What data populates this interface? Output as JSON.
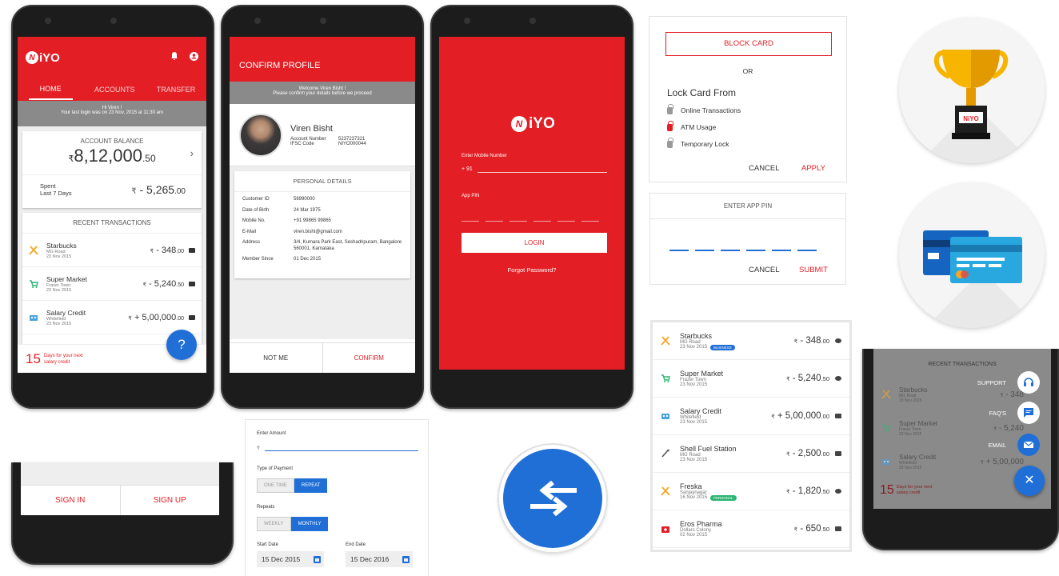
{
  "brand": {
    "logo_text": "NiYO",
    "accent": "#e31e24",
    "blue": "#1f6fd6"
  },
  "home": {
    "tabs": [
      "HOME",
      "ACCOUNTS",
      "TRANSFER"
    ],
    "greeting": "Hi Viren !",
    "last_login": "Your last login was on 23 Nov, 2015 at 11:30 am",
    "balance_label": "ACCOUNT BALANCE",
    "balance_main": "8,12,000",
    "balance_dec": ".50",
    "spent_label": "Spent",
    "spent_period": "Last 7 Days",
    "spent_main": "- 5,265",
    "spent_dec": ".00",
    "recent_title": "RECENT TRANSACTIONS",
    "transactions": [
      {
        "name": "Starbucks",
        "place": "MG Road",
        "date": "23 Nov 2015",
        "amount": "- 348",
        "dec": ".00",
        "icon": "fork-knife-icon"
      },
      {
        "name": "Super Market",
        "place": "Frazer Town",
        "date": "23 Nov 2015",
        "amount": "- 5,240",
        "dec": ".50",
        "icon": "cart-icon"
      },
      {
        "name": "Salary Credit",
        "place": "Whitefield",
        "date": "23 Nov 2015",
        "amount": "+ 5,00,000",
        "dec": ".00",
        "icon": "building-icon"
      }
    ],
    "days_num": "15",
    "days_text1": "Days for your next",
    "days_text2": "salary credit",
    "help": "?"
  },
  "confirm": {
    "title": "CONFIRM PROFILE",
    "welcome": "Welcome Viren Bisht !",
    "instruction": "Please confirm your details before we proceed",
    "name": "Viren Bisht",
    "acct_label": "Account Number",
    "acct_value": "5237237321",
    "ifsc_label": "IFSC Code",
    "ifsc_value": "NIYO000044",
    "section": "PERSONAL DETAILS",
    "details": [
      {
        "label": "Customer ID",
        "value": "56990000"
      },
      {
        "label": "Date of Birth",
        "value": "24 Mar 1975"
      },
      {
        "label": "Mobile No.",
        "value": "+91 99865 99865"
      },
      {
        "label": "E-Mail",
        "value": "viren.bisht@gmail.com"
      },
      {
        "label": "Address",
        "value": "3/4, Kumara Park East, Seshadripuram, Bangalore 560001, Karnataka"
      },
      {
        "label": "Member Since",
        "value": "01 Dec 2015"
      }
    ],
    "not_me": "NOT ME",
    "confirm_btn": "CONFIRM"
  },
  "login": {
    "mobile_label": "Enter Mobile Number",
    "prefix": "+ 91",
    "pin_label": "App PIN",
    "login_btn": "LOGIN",
    "forgot": "Forgot Password?"
  },
  "block": {
    "block_btn": "BLOCK CARD",
    "or": "OR",
    "lock_title": "Lock Card From",
    "options": [
      "Online Transactions",
      "ATM Usage",
      "Temporary Lock"
    ],
    "cancel": "CANCEL",
    "apply": "APPLY"
  },
  "pin": {
    "title": "ENTER APP PIN",
    "cancel": "CANCEL",
    "submit": "SUBMIT"
  },
  "signin": {
    "sign_in": "SIGN IN",
    "sign_up": "SIGN UP"
  },
  "payment": {
    "amount_label": "Enter Amount",
    "rupee": "₹",
    "type_label": "Type of Payment",
    "type_opts": [
      "ONE TIME",
      "REPEAT"
    ],
    "repeats_label": "Repeats",
    "repeat_opts": [
      "WEEKLY",
      "MONTHLY"
    ],
    "start_label": "Start Date",
    "start_value": "15 Dec 2015",
    "end_label": "End Date",
    "end_value": "15 Dec 2016"
  },
  "txlist": [
    {
      "name": "Starbucks",
      "place": "MG Road",
      "date": "23 Nov 2015",
      "tag": "BUSINESS",
      "amount": "- 348",
      "dec": ".00",
      "icon": "fork-knife-icon"
    },
    {
      "name": "Super Market",
      "place": "Frazer Town",
      "date": "23 Nov 2015",
      "tag": "",
      "amount": "- 5,240",
      "dec": ".50",
      "icon": "cart-icon"
    },
    {
      "name": "Salary Credit",
      "place": "Whitefield",
      "date": "23 Nov 2015",
      "tag": "",
      "amount": "+ 5,00,000",
      "dec": ".00",
      "icon": "building-icon"
    },
    {
      "name": "Shell Fuel Station",
      "place": "MG Road",
      "date": "23 Nov 2015",
      "tag": "",
      "amount": "- 2,500",
      "dec": ".00",
      "icon": "fuel-icon"
    },
    {
      "name": "Freska",
      "place": "Sanjaynagar",
      "date": "16 Nov 2015",
      "tag": "PERSONAL",
      "amount": "- 1,820",
      "dec": ".50",
      "icon": "fork-knife-icon"
    },
    {
      "name": "Eros Pharma",
      "place": "Dollars Colony",
      "date": "02 Nov 2015",
      "tag": "",
      "amount": "- 650",
      "dec": ".50",
      "icon": "pharmacy-icon"
    }
  ],
  "fab_menu": {
    "recent_title": "RECENT TRANSACTIONS",
    "items": [
      "SUPPORT",
      "FAQ'S",
      "EMAIL"
    ],
    "bg_rows": [
      {
        "name": "Starbucks",
        "place": "MG Road",
        "date": "23 Nov 2015",
        "amount": "- 348"
      },
      {
        "name": "Super Market",
        "place": "Frazer Town",
        "date": "23 Nov 2015",
        "amount": "- 5,240"
      },
      {
        "name": "Salary Credit",
        "place": "Whitefield",
        "date": "23 Nov 2015",
        "amount": "+ 5,00,000"
      }
    ],
    "days_num": "15",
    "days_text1": "Days for your next",
    "days_text2": "salary credit"
  }
}
